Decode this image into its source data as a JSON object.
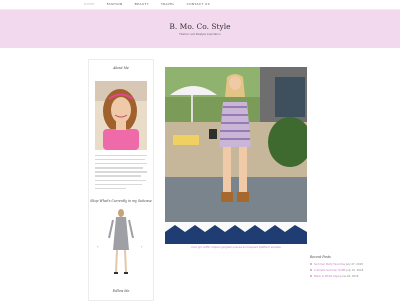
{
  "nav": {
    "items": [
      "HOME",
      "FASHION",
      "BEAUTY",
      "TRAVEL",
      "CONTACT US"
    ],
    "active_index": 0,
    "search_icon": "search-icon"
  },
  "header": {
    "title": "B. Mo. Co. Style",
    "tagline": "Fashion and lifestyle inspiration"
  },
  "sidebar": {
    "about_heading": "About Me",
    "product_heading": "Shop What's Currently in my Suitcase",
    "follow_heading": "Follow Me",
    "prev_arrow": "‹",
    "next_arrow": "›"
  },
  "main": {
    "caption": "Cool girl outfit: striped gingham pieces and leopard platform sandals"
  },
  "recent_posts": {
    "heading": "Recent Posts",
    "items": [
      {
        "title": "Summer Party Favorites",
        "date": "July 27, 2018"
      },
      {
        "title": "A Simple Summer Outfit",
        "date": "July 10, 2018"
      },
      {
        "title": "Black & White Style",
        "date": "June 26, 2018"
      }
    ]
  },
  "colors": {
    "header_bg": "#f3d9ee",
    "accent": "#c27bc4"
  }
}
